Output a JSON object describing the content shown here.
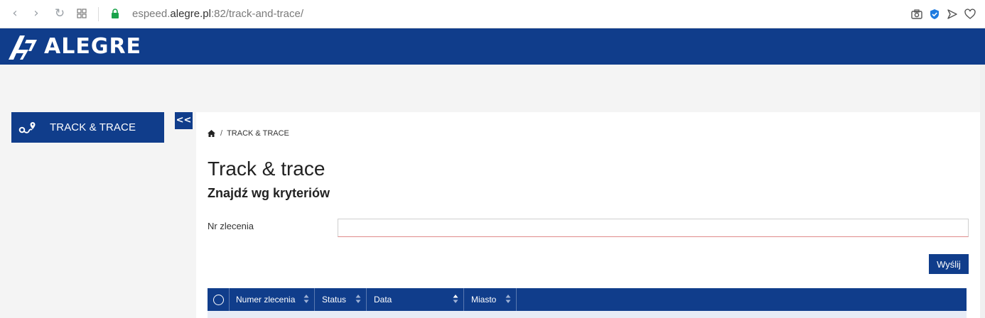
{
  "browser": {
    "url_prefix": "espeed.",
    "url_domain": "alegre.pl",
    "url_suffix": ":82/track-and-trace/",
    "icons": [
      "back-icon",
      "forward-icon",
      "reload-icon",
      "speed-dial-icon",
      "lock-icon",
      "camera-icon",
      "shield-icon",
      "send-icon",
      "heart-icon"
    ]
  },
  "header": {
    "logo_text": "ALEGRE",
    "color": "#103d8b"
  },
  "sidebar": {
    "items": [
      {
        "label": "TRACK & TRACE",
        "icon": "route-icon"
      }
    ],
    "collapse_label": "<<"
  },
  "breadcrumb": {
    "separator": "/",
    "current": "TRACK & TRACE"
  },
  "main": {
    "title": "Track & trace",
    "subtitle": "Znajdź wg kryteriów",
    "form": {
      "order_label": "Nr zlecenia",
      "order_value": "",
      "submit_label": "Wyślij"
    },
    "table": {
      "columns": [
        "Numer zlecenia",
        "Status",
        "Data",
        "Miasto"
      ]
    }
  }
}
